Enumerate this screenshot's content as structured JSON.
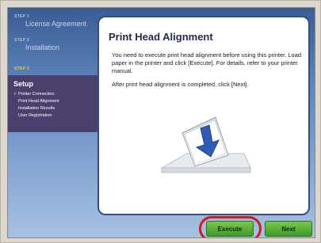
{
  "steps": [
    {
      "tag": "STEP 1",
      "title": "License Agreement"
    },
    {
      "tag": "STEP 2",
      "title": "Installation"
    },
    {
      "tag": "STEP 3",
      "title": "Setup"
    }
  ],
  "setup_list": [
    {
      "label": "Printer Connection",
      "checked": true
    },
    {
      "label": "Print Head Alignment",
      "checked": false
    },
    {
      "label": "Installation Results",
      "checked": false
    },
    {
      "label": "User Registration",
      "checked": false
    }
  ],
  "main": {
    "title": "Print Head Alignment",
    "paragraph1": "You need to execute print head alignment before using this printer. Load paper in the printer and click [Execute]. For details, refer to your printer manual.",
    "paragraph2": "After print head alignment is completed, click [Next]."
  },
  "buttons": {
    "execute_label": "Execute",
    "next_label": "Next"
  },
  "colors": {
    "accent_step": "#ffcf3a",
    "button_green": "#3f9b27",
    "highlight_red": "#d21c1c",
    "setup_box": "#4b3f6e"
  }
}
